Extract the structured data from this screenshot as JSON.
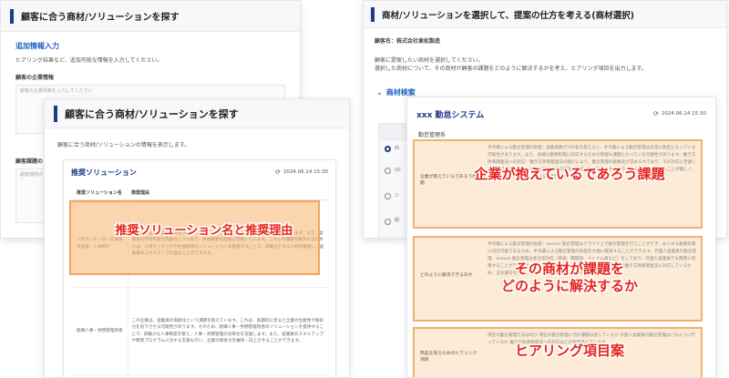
{
  "window1": {
    "title": "顧客に合う商材/ソリューションを探す",
    "section": "追加情報入力",
    "instruction": "ヒアリング結果など、追加可能な情報を入力してください。",
    "field1_label": "顧客の企業情報",
    "field1_placeholder": "顧客の企業情報を入力してください",
    "field2_label": "顧客課題の",
    "field2_placeholder": "顧客課題の"
  },
  "window2": {
    "title": "顧客に合う商材/ソリューションを探す",
    "subtitle": "顧客に合う商材/ソリューションの情報を表示します。",
    "card_title": "推奨ソリューション",
    "timestamp": "2024.06.14 15:30",
    "col_name": "推奨ソリューション名",
    "col_reason": "推奨理由",
    "rows": [
      {
        "name": "人材マッチング・社員研修支援・人材紹介",
        "reason": "この企業は、従業員の教育が遅れており、営業を中心にした人材不足の課題を抱えています。また、従業員の平均年齢が高齢化しつつあり、新規顧客の開拓に苦戦しています。これらの課題を解決するためには、人材マッチングや社員研修のソリューションを提供することで、即戦力となる人材を確保し、従業員のスキルアップを図ることができます。"
      },
      {
        "name": "組織人事・労務管理改善",
        "reason": "この企業は、従業員の高齢化という課題を抱えています。これは、長期的に見ると企業の生産性や競争力を低下させる可能性があります。そのため、組織人事・労務管理改善のソリューションを提供することで、即戦力な人事制度を整え、人事・労務管理の効率化を支援します。また、従業員のスキルアップや教育プログラムに対する支援も行い、企業の競争力を維持・向上させることができます。"
      }
    ]
  },
  "window3": {
    "title": "商材/ソリューションを選択して、提案の仕方を考える(商材選択)",
    "client_label": "顧客名：株式会社東松製造",
    "instruction1": "顧客に提案したい商材を選択してください。",
    "instruction2": "選択した商材について、その商材が顧客の課題をどのように解決するかを考え、ヒアリング項目を出力します。",
    "search_label": "商材検索",
    "options": [
      "商",
      "OC",
      "ジ",
      "組"
    ]
  },
  "window4": {
    "title": "xxx 勤怠システム",
    "timestamp": "2024.06.14 15:30",
    "subtitle": "勤怠管理系",
    "sections": [
      {
        "label": "企業が抱えているであろう課題",
        "body": "手作業による勤怠管理の負担：従業員数が100名を超えると、手作業による勤怠管理は非常に負担となっている可能性があります。また、多様な勤務形態に対応するための管理も課題となっている可能性があります。働き方改革関連法への対応：働き方改革関連法の施行により、勤怠管理の厳格化が求められており、その対応に苦慮している可能性があります。従業員の勤怠状況の把握：勤怠管理をする上で、勤怠状況を把握することが難しく、管理の負担が大きくなっている可能性があります。"
      },
      {
        "label": "どのように解決できるのか",
        "body": "手作業による勤怠管理の負担：xxxxxx 勤怠管理はクラウド上で勤怠管理を行うことができ、あらゆる勤務形態に対応可能であるため、手作業による勤怠管理の負担を大幅に軽減することができます。外国人従業員の勤怠管理：xxxxxx 勤怠管理は多言語対応（英語、韓国語、ベトナム語など）をしており、外国人従業員でも簡単に利用することができます。働き方改革関連法への対応：xxxxxx 勤怠管理は働き方改革関連法に対応しているため、法令遵守を強化しながら効率的な勤怠管理を行うことができます。"
      },
      {
        "label": "商品を売るためのヒアリング項目",
        "body": "現在の勤怠管理方法は何か 現在の勤怠管理に何か課題は感じているか 外国人従業員の勤怠管理はどのように行っているか 働き方改革関連法への対応はどの程度進んでいるか"
      }
    ]
  },
  "captions": {
    "reason": "推奨ソリューション名と推奨理由",
    "issue": "企業が抱えているであろう課題",
    "solve_line1": "その商材が課題を",
    "solve_line2": "どのように解決するか",
    "hearing": "ヒアリング項目案"
  },
  "colors": {
    "accent": "#1f3a8a",
    "link_blue": "#1f5fbf",
    "highlight_fill": "#f6b26b",
    "highlight_border": "#f3a45e",
    "caption_red": "#e6251a"
  }
}
